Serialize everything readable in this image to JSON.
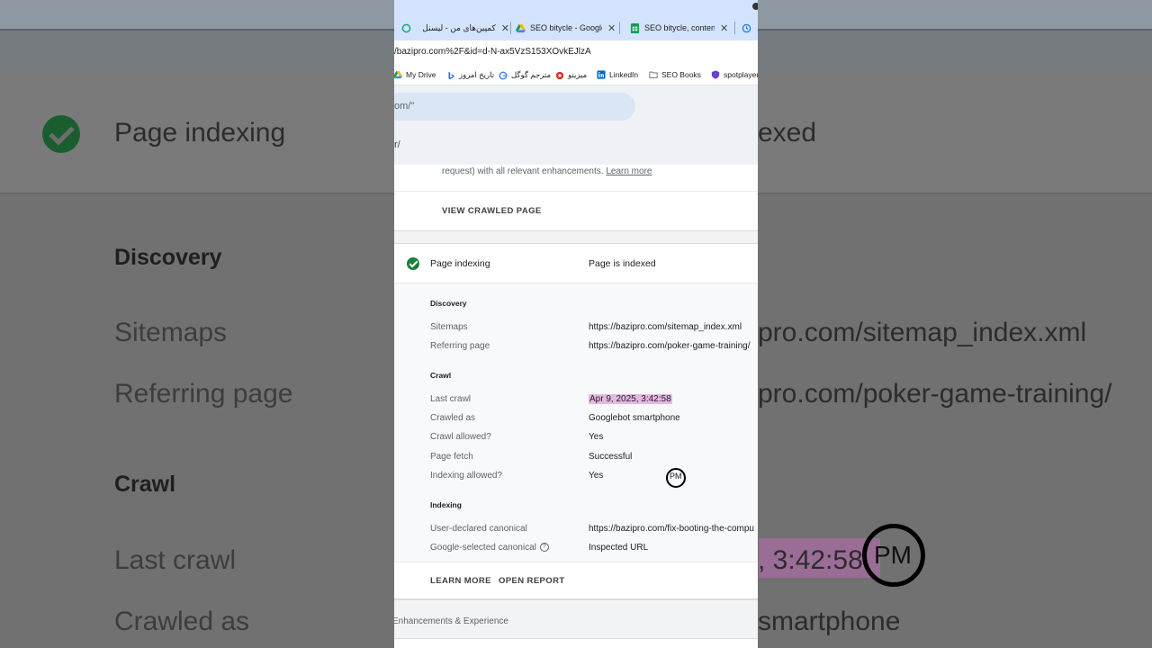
{
  "background": {
    "page_indexing": "Page indexing",
    "indexed_fragment": "exed",
    "discovery": "Discovery",
    "sitemaps": "Sitemaps",
    "sitemap_value_fragment": "pro.com/sitemap_index.xml",
    "referring_page": "Referring page",
    "referring_value_fragment": "pro.com/poker-game-training/",
    "crawl": "Crawl",
    "last_crawl": "Last crawl",
    "last_crawl_value_fragment": ", 3:42:58",
    "crawled_as": "Crawled as",
    "crawled_as_value_fragment": "smartphone"
  },
  "tabs": [
    {
      "title": "کمپین‌های من - لیسنل",
      "icon": "circle-arrow-icon"
    },
    {
      "title": "SEO bitycle - Google",
      "icon": "google-drive-icon"
    },
    {
      "title": "SEO bitycle, content",
      "icon": "google-sheets-icon"
    }
  ],
  "address_bar": {
    "url": "/bazipro.com%2F&id=d-N-ax5VzS153XOvkEJlzA"
  },
  "bookmarks": [
    {
      "label": "My Drive",
      "icon": "google-drive-icon"
    },
    {
      "label": "تاریخ امروز",
      "icon": "bing-icon"
    },
    {
      "label": "مترجم گوگل",
      "icon": "google-icon"
    },
    {
      "label": "میزیتو",
      "icon": "mizito-icon"
    },
    {
      "label": "LinkedIn",
      "icon": "linkedin-icon"
    },
    {
      "label": "SEO Books",
      "icon": "folder-icon"
    },
    {
      "label": "spotplayer",
      "icon": "shield-icon"
    }
  ],
  "inspect": {
    "search_text": "om/\"",
    "sub_url": "r/"
  },
  "card1": {
    "description": "request) with all relevant enhancements.",
    "learn_more": "Learn more",
    "view_button": "VIEW CRAWLED PAGE"
  },
  "indexing_card": {
    "title": "Page indexing",
    "status": "Page is indexed",
    "discovery_header": "Discovery",
    "sitemaps_label": "Sitemaps",
    "sitemaps_value": "https://bazipro.com/sitemap_index.xml",
    "referring_label": "Referring page",
    "referring_value": "https://bazipro.com/poker-game-training/",
    "crawl_header": "Crawl",
    "last_crawl_label": "Last crawl",
    "last_crawl_value": "Apr 9, 2025, 3:42:58",
    "last_crawl_suffix": "PM",
    "crawled_as_label": "Crawled as",
    "crawled_as_value": "Googlebot smartphone",
    "crawl_allowed_label": "Crawl allowed?",
    "crawl_allowed_value": "Yes",
    "page_fetch_label": "Page fetch",
    "page_fetch_value": "Successful",
    "indexing_allowed_label": "Indexing allowed?",
    "indexing_allowed_value": "Yes",
    "indexing_header": "Indexing",
    "user_canonical_label": "User-declared canonical",
    "user_canonical_value": "https://bazipro.com/fix-booting-the-compu",
    "google_canonical_label": "Google-selected canonical",
    "google_canonical_value": "Inspected URL",
    "learn_more_button": "LEARN MORE",
    "open_report_button": "OPEN REPORT"
  },
  "enhancements": {
    "label": "Enhancements & Experience"
  },
  "colors": {
    "success_green": "#188038",
    "highlight_pink": "#e8b7e3",
    "tab_strip": "#d3e3fd"
  }
}
